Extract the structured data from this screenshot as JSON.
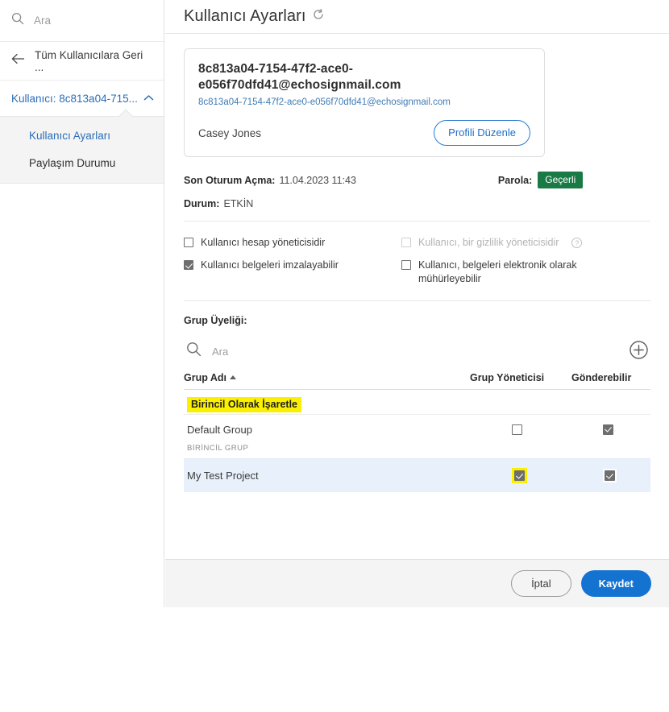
{
  "sidebar": {
    "search": {
      "placeholder": "Ara",
      "icon": "search-icon"
    },
    "back": {
      "label": "Tüm Kullanıcılara Geri ...",
      "icon": "arrow-left-icon"
    },
    "user_group": {
      "label": "Kullanıcı: 8c813a04-715...",
      "icon": "chevron-up-icon"
    },
    "submenu": [
      {
        "label": "Kullanıcı Ayarları",
        "active": true
      },
      {
        "label": "Paylaşım Durumu",
        "active": false
      }
    ]
  },
  "header": {
    "title": "Kullanıcı Ayarları",
    "refresh_icon": "refresh-icon"
  },
  "profile": {
    "email_display": "8c813a04-7154-47f2-ace0-e056f70dfd41@echosignmail.com",
    "email_link": "8c813a04-7154-47f2-ace0-e056f70dfd41@echosignmail.com",
    "name": "Casey Jones",
    "edit_button": "Profili Düzenle"
  },
  "status": {
    "last_login_label": "Son Oturum Açma:",
    "last_login_value": "11.04.2023 11:43",
    "password_label": "Parola:",
    "password_badge": "Geçerli",
    "password_badge_color": "#1a7a46",
    "state_label": "Durum:",
    "state_value": "ETKİN"
  },
  "permissions": [
    {
      "label": "Kullanıcı hesap yöneticisidir",
      "checked": false,
      "disabled": false,
      "help": false
    },
    {
      "label": "Kullanıcı, bir gizlilik yöneticisidir",
      "checked": false,
      "disabled": true,
      "help": true
    },
    {
      "label": "Kullanıcı belgeleri imzalayabilir",
      "checked": true,
      "disabled": false,
      "help": false
    },
    {
      "label": "Kullanıcı, belgeleri elektronik olarak mühürleyebilir",
      "checked": false,
      "disabled": false,
      "help": false
    }
  ],
  "groups": {
    "section_title": "Grup Üyeliği:",
    "search_placeholder": "Ara",
    "search_icon": "search-icon",
    "add_icon": "add-circle-icon",
    "columns": {
      "name": "Grup Adı",
      "sort_icon": "caret-up-icon",
      "group_admin": "Grup Yöneticisi",
      "can_send": "Gönderebilir"
    },
    "primary_action": "Birincil Olarak İşaretle",
    "primary_action_highlight": "#fbf000",
    "rows": [
      {
        "name": "Default Group",
        "group_admin": false,
        "can_send": true,
        "sublabel": "BİRİNCİL GRUP",
        "selected": false,
        "highlight_admin": false
      },
      {
        "name": "My Test Project",
        "group_admin": true,
        "can_send": true,
        "sublabel": "",
        "selected": true,
        "highlight_admin": true
      }
    ]
  },
  "footer": {
    "cancel": "İptal",
    "save": "Kaydet",
    "save_color": "#1473d1"
  }
}
